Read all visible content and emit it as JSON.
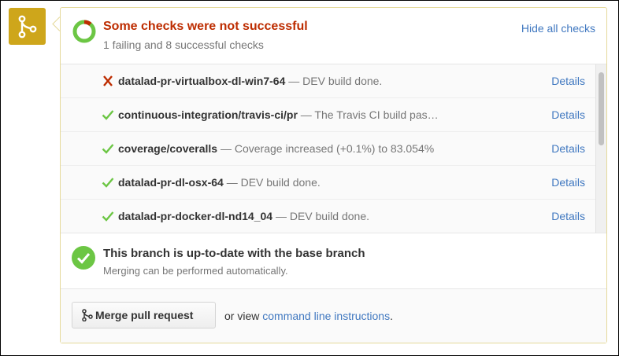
{
  "status": {
    "title": "Some checks were not successful",
    "subtitle": "1 failing and 8 successful checks",
    "hide_label": "Hide all checks",
    "success_fraction": 0.889,
    "colors": {
      "success": "#6cc644",
      "failure": "#bd2c00"
    }
  },
  "checks": [
    {
      "name": "datalad-pr-virtualbox-dl-win7-64",
      "description": "— DEV build done.",
      "state": "failure",
      "icon": "x-icon",
      "details_label": "Details"
    },
    {
      "name": "continuous-integration/travis-ci/pr",
      "description": "— The Travis CI build pas…",
      "state": "success",
      "icon": "check-icon",
      "details_label": "Details"
    },
    {
      "name": "coverage/coveralls",
      "description": "— Coverage increased (+0.1%) to 83.054%",
      "state": "success",
      "icon": "check-icon",
      "details_label": "Details"
    },
    {
      "name": "datalad-pr-dl-osx-64",
      "description": "— DEV build done.",
      "state": "success",
      "icon": "check-icon",
      "details_label": "Details"
    },
    {
      "name": "datalad-pr-docker-dl-nd14_04",
      "description": "— DEV build done.",
      "state": "success",
      "icon": "check-icon",
      "details_label": "Details"
    }
  ],
  "branch": {
    "title": "This branch is up-to-date with the base branch",
    "subtitle": "Merging can be performed automatically."
  },
  "merge": {
    "button_label": "Merge pull request",
    "or_view": "or view",
    "cli_label": "command line instructions",
    "period": "."
  }
}
